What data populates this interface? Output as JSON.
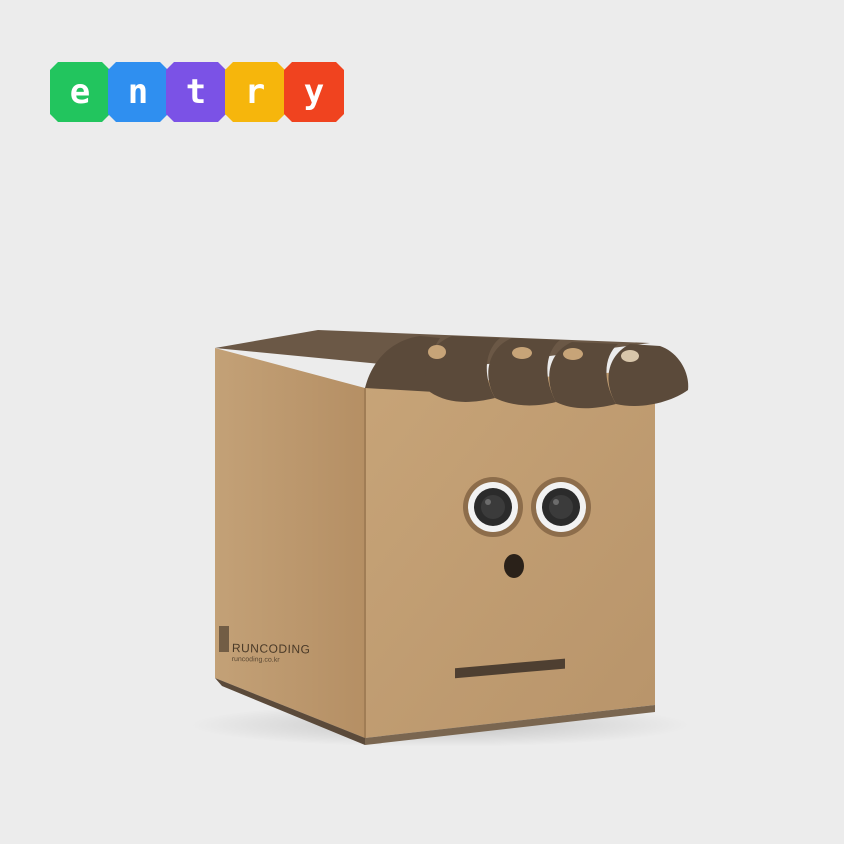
{
  "logo": {
    "letters": [
      "e",
      "n",
      "t",
      "r",
      "y"
    ],
    "colors": [
      "#22c55e",
      "#2f8ff0",
      "#7b52e6",
      "#f6b60c",
      "#f0431f"
    ]
  },
  "box": {
    "brand_name": "RUNCODING",
    "brand_url": "runcoding.co.kr"
  },
  "colors": {
    "background": "#ececec",
    "cardboard": "#c29d71",
    "cardboard_dark": "#5b4a3a",
    "sensor": "#2b2b2b"
  }
}
